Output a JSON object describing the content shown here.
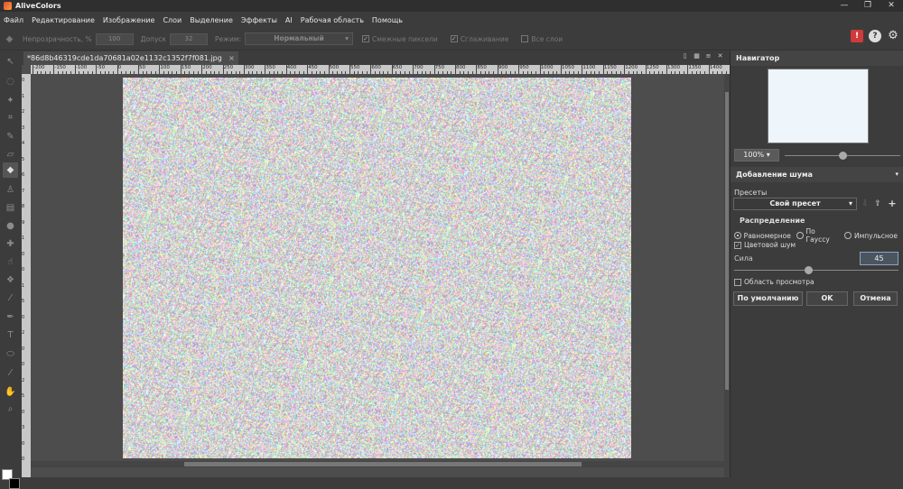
{
  "app": {
    "title": "AliveColors"
  },
  "window": {
    "minimize": "—",
    "maximize": "❐",
    "close": "✕"
  },
  "menu": [
    "Файл",
    "Редактирование",
    "Изображение",
    "Слои",
    "Выделение",
    "Эффекты",
    "AI",
    "Рабочая область",
    "Помощь"
  ],
  "options": {
    "opacity_label": "Непрозрачность, %",
    "opacity_value": "100",
    "tolerance_label": "Допуск",
    "tolerance_value": "32",
    "mode_label": "Режим:",
    "mode_value": "Нормальный",
    "adjacent_label": "Смежные пиксели",
    "smoothing_label": "Сглаживание",
    "all_layers_label": "Все слои"
  },
  "document": {
    "tab_name": "*86d8b46319cde1da70681a02e1132c1352f7f081.jpg",
    "ruler_h": [
      "-200",
      "-150",
      "-100",
      "-50",
      "0",
      "50",
      "100",
      "150",
      "200",
      "250",
      "300",
      "350",
      "400",
      "450",
      "500",
      "550",
      "600",
      "650",
      "700",
      "750",
      "800",
      "850",
      "900",
      "950",
      "1000",
      "1050",
      "1100",
      "1150",
      "1200",
      "1250",
      "1300",
      "1350",
      "1400"
    ],
    "ruler_v": [
      "0",
      "1",
      "2",
      "3",
      "4",
      "5",
      "6",
      "7",
      "8",
      "9",
      "1",
      "0",
      "0",
      "1",
      "5",
      "0",
      "2",
      "0",
      "0",
      "2",
      "5",
      "0",
      "3",
      "0",
      "0"
    ]
  },
  "navigator": {
    "title": "Навигатор",
    "zoom": "100%"
  },
  "noise_panel": {
    "title": "Добавление шума",
    "presets_label": "Пресеты",
    "preset_value": "Свой пресет",
    "distribution_label": "Распределение",
    "dist_uniform": "Равномерное",
    "dist_gauss": "По Гауссу",
    "dist_impulse": "Импульсное",
    "color_noise_label": "Цветовой шум",
    "strength_label": "Сила",
    "strength_value": "45",
    "strength_level": 0.45,
    "preview_area_label": "Область просмотра",
    "default_button": "По умолчанию",
    "ok_button": "OK",
    "cancel_button": "Отмена"
  },
  "colors": {
    "accent_warn": "#d13a3a",
    "canvas_base": "#d6d4d6"
  }
}
